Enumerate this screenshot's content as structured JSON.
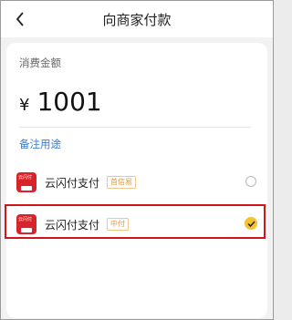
{
  "header": {
    "title": "向商家付款",
    "back_icon": "chevron-left-icon"
  },
  "payment": {
    "amount_label": "消费金额",
    "currency": "¥",
    "amount": "1001",
    "remark_link": "备注用途"
  },
  "methods": [
    {
      "name": "云闪付支付",
      "tag": "首信易",
      "selected": false,
      "logo_text": "云闪付"
    },
    {
      "name": "云闪付支付",
      "tag": "中付",
      "selected": true,
      "logo_text": "云闪付"
    }
  ],
  "colors": {
    "accent_blue": "#3d7bd6",
    "check_yellow": "#f4c430",
    "logo_red": "#d8232a",
    "highlight_red": "#d2151b",
    "tag_orange": "#e39a3c"
  }
}
